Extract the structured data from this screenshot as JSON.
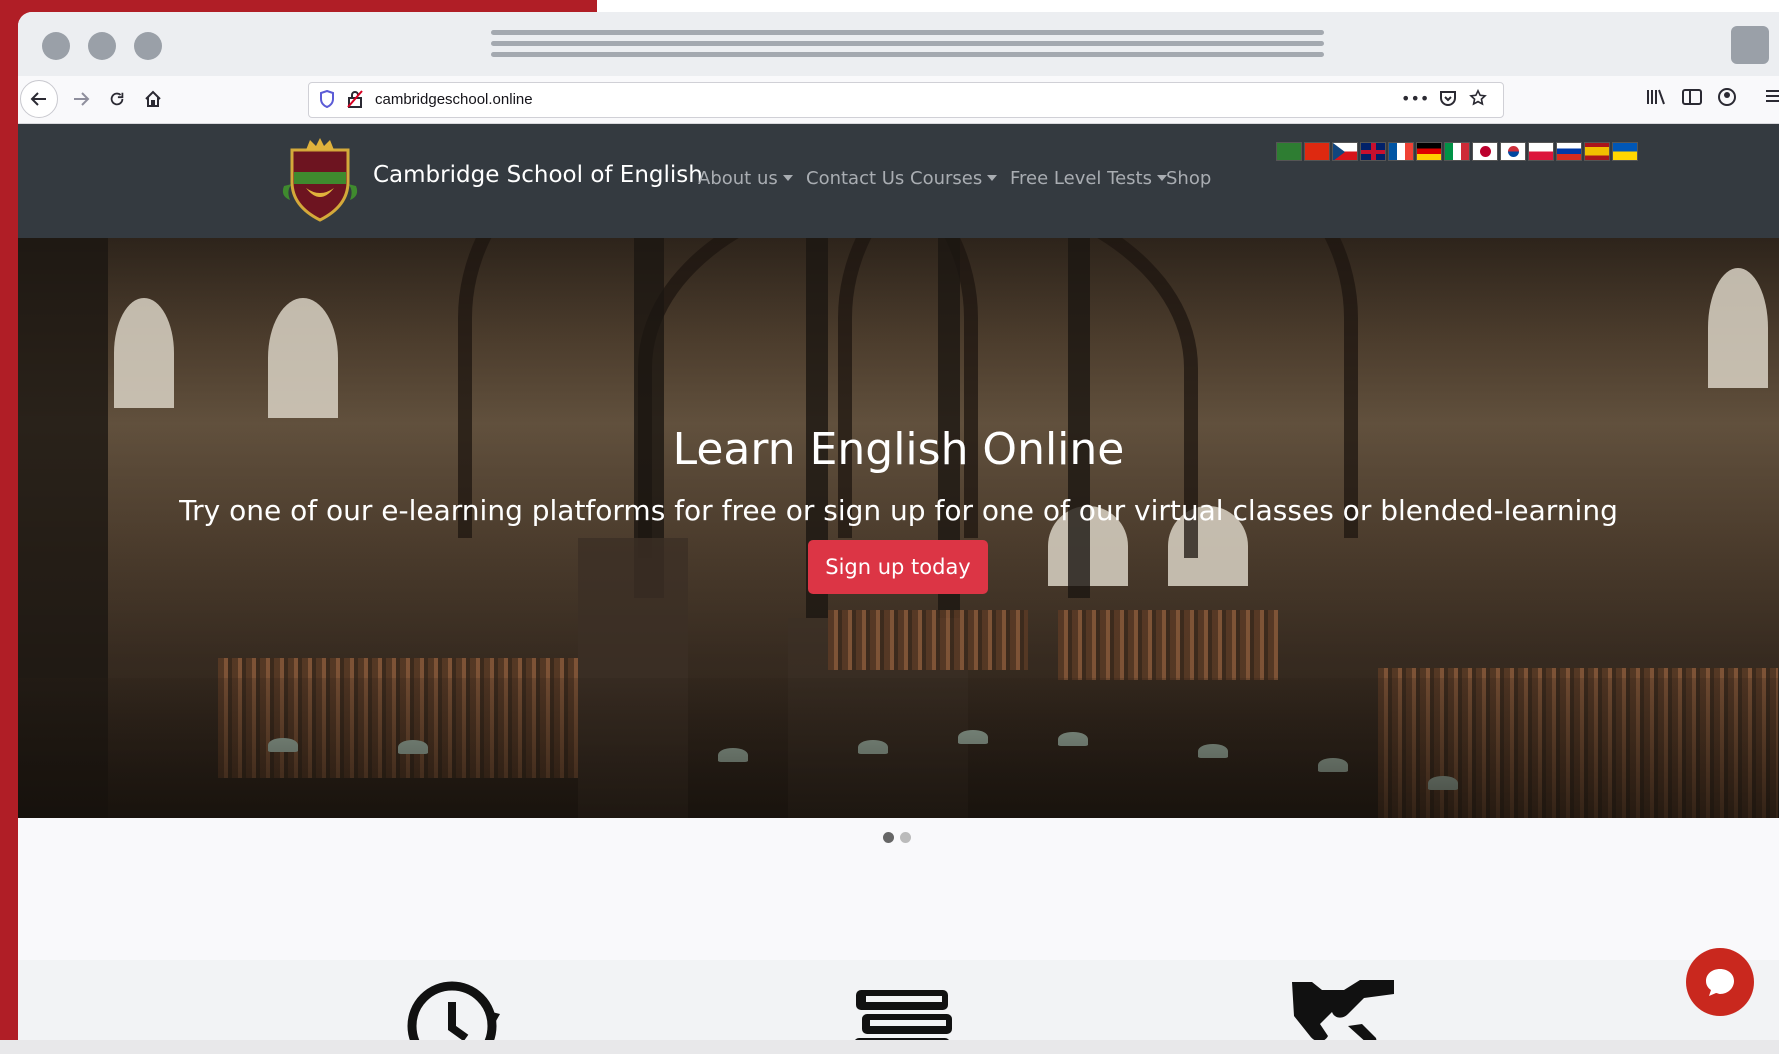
{
  "browser": {
    "url": "cambridgeschool.online"
  },
  "site": {
    "brand": "Cambridge School of English",
    "nav": [
      {
        "label": "About us",
        "dropdown": true
      },
      {
        "label": "Contact Us",
        "dropdown": false
      },
      {
        "label": "Courses",
        "dropdown": true
      },
      {
        "label": "Free Level Tests",
        "dropdown": true
      },
      {
        "label": "Shop",
        "dropdown": false
      }
    ],
    "flags": [
      "arabic",
      "chinese",
      "czech",
      "english",
      "french",
      "german",
      "italian",
      "japanese",
      "korean",
      "polish",
      "russian",
      "spanish",
      "ukrainian"
    ]
  },
  "hero": {
    "title": "Learn English Online",
    "subtitle": "Try one of our e-learning platforms for free or sign up for one of our virtual classes or blended-learning",
    "cta": "Sign up today",
    "slides": 2,
    "active_slide": 1
  },
  "features": {
    "icons": [
      "clock-icon",
      "books-icon",
      "handshake-icon"
    ]
  },
  "colors": {
    "nav_bg": "#343a40",
    "cta": "#dc3545",
    "frame": "#b01e26",
    "chat": "#c9281e"
  }
}
